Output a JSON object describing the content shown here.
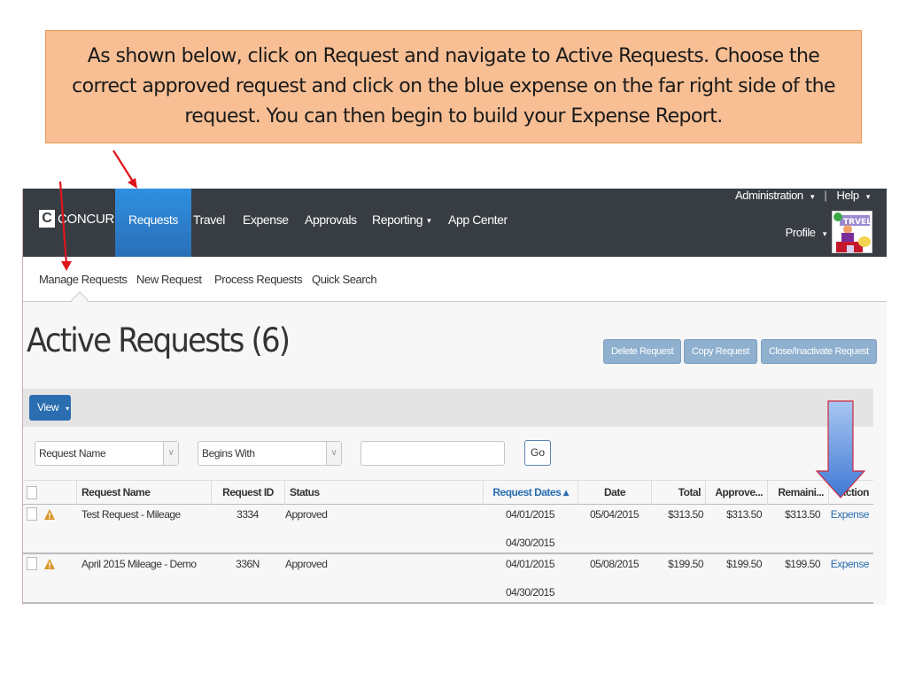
{
  "callout": {
    "text": "As shown below, click on Request and navigate to Active Requests.  Choose the correct approved request and click on the blue expense on the far right side of the request.  You can then begin to build your Expense Report."
  },
  "topnav": {
    "logo_mark": "C",
    "logo_text": "CONCUR",
    "items": [
      {
        "label": "Requests",
        "active": true
      },
      {
        "label": "Travel"
      },
      {
        "label": "Expense"
      },
      {
        "label": "Approvals"
      },
      {
        "label": "Reporting",
        "dropdown": true
      },
      {
        "label": "App Center"
      }
    ],
    "admin_label": "Administration",
    "help_label": "Help",
    "profile_label": "Profile",
    "caret": "▾",
    "separator": "|"
  },
  "subnav": {
    "items": [
      "Manage Requests",
      "New Request",
      "Process Requests",
      "Quick Search"
    ],
    "active_index": 0
  },
  "page": {
    "title": "Active Requests (6)",
    "actions": [
      "Delete Request",
      "Copy Request",
      "Close/Inactivate Request"
    ],
    "view_label": "View",
    "view_caret": "▾"
  },
  "filter": {
    "field_value": "Request Name",
    "operator_value": "Begins With",
    "search_value": "",
    "go_label": "Go",
    "dd_glyph": "∨"
  },
  "table": {
    "columns": [
      "Request Name",
      "Request ID",
      "Status",
      "Request Dates ▴",
      "Date Submitted",
      "Total",
      "Approve...",
      "Remaini...",
      "Action"
    ],
    "sorted_column": "Request Dates",
    "rows": [
      {
        "name": "Test Request - Mileage",
        "id": "3334",
        "status": "Approved",
        "date_start": "04/01/2015",
        "date_end": "04/30/2015",
        "submitted": "05/04/2015",
        "total": "$313.50",
        "approved": "$313.50",
        "remaining": "$313.50",
        "action": "Expense",
        "warning_icon": "warning-triangle"
      },
      {
        "name": "April 2015 Mileage - Demo",
        "id": "336N",
        "status": "Approved",
        "date_start": "04/01/2015",
        "date_end": "04/30/2015",
        "submitted": "05/08/2015",
        "total": "$199.50",
        "approved": "$199.50",
        "remaining": "$199.50",
        "action": "Expense",
        "warning_icon": "warning-triangle"
      }
    ]
  },
  "colors": {
    "callout_bg": "#f8bf94",
    "nav_bg": "#383d43",
    "nav_active": "#2f8fe0",
    "primary_blue": "#2a6db0",
    "disabled_btn": "#8fb0cf",
    "annotation_red": "#e0141b",
    "warning": "#d9962a"
  }
}
